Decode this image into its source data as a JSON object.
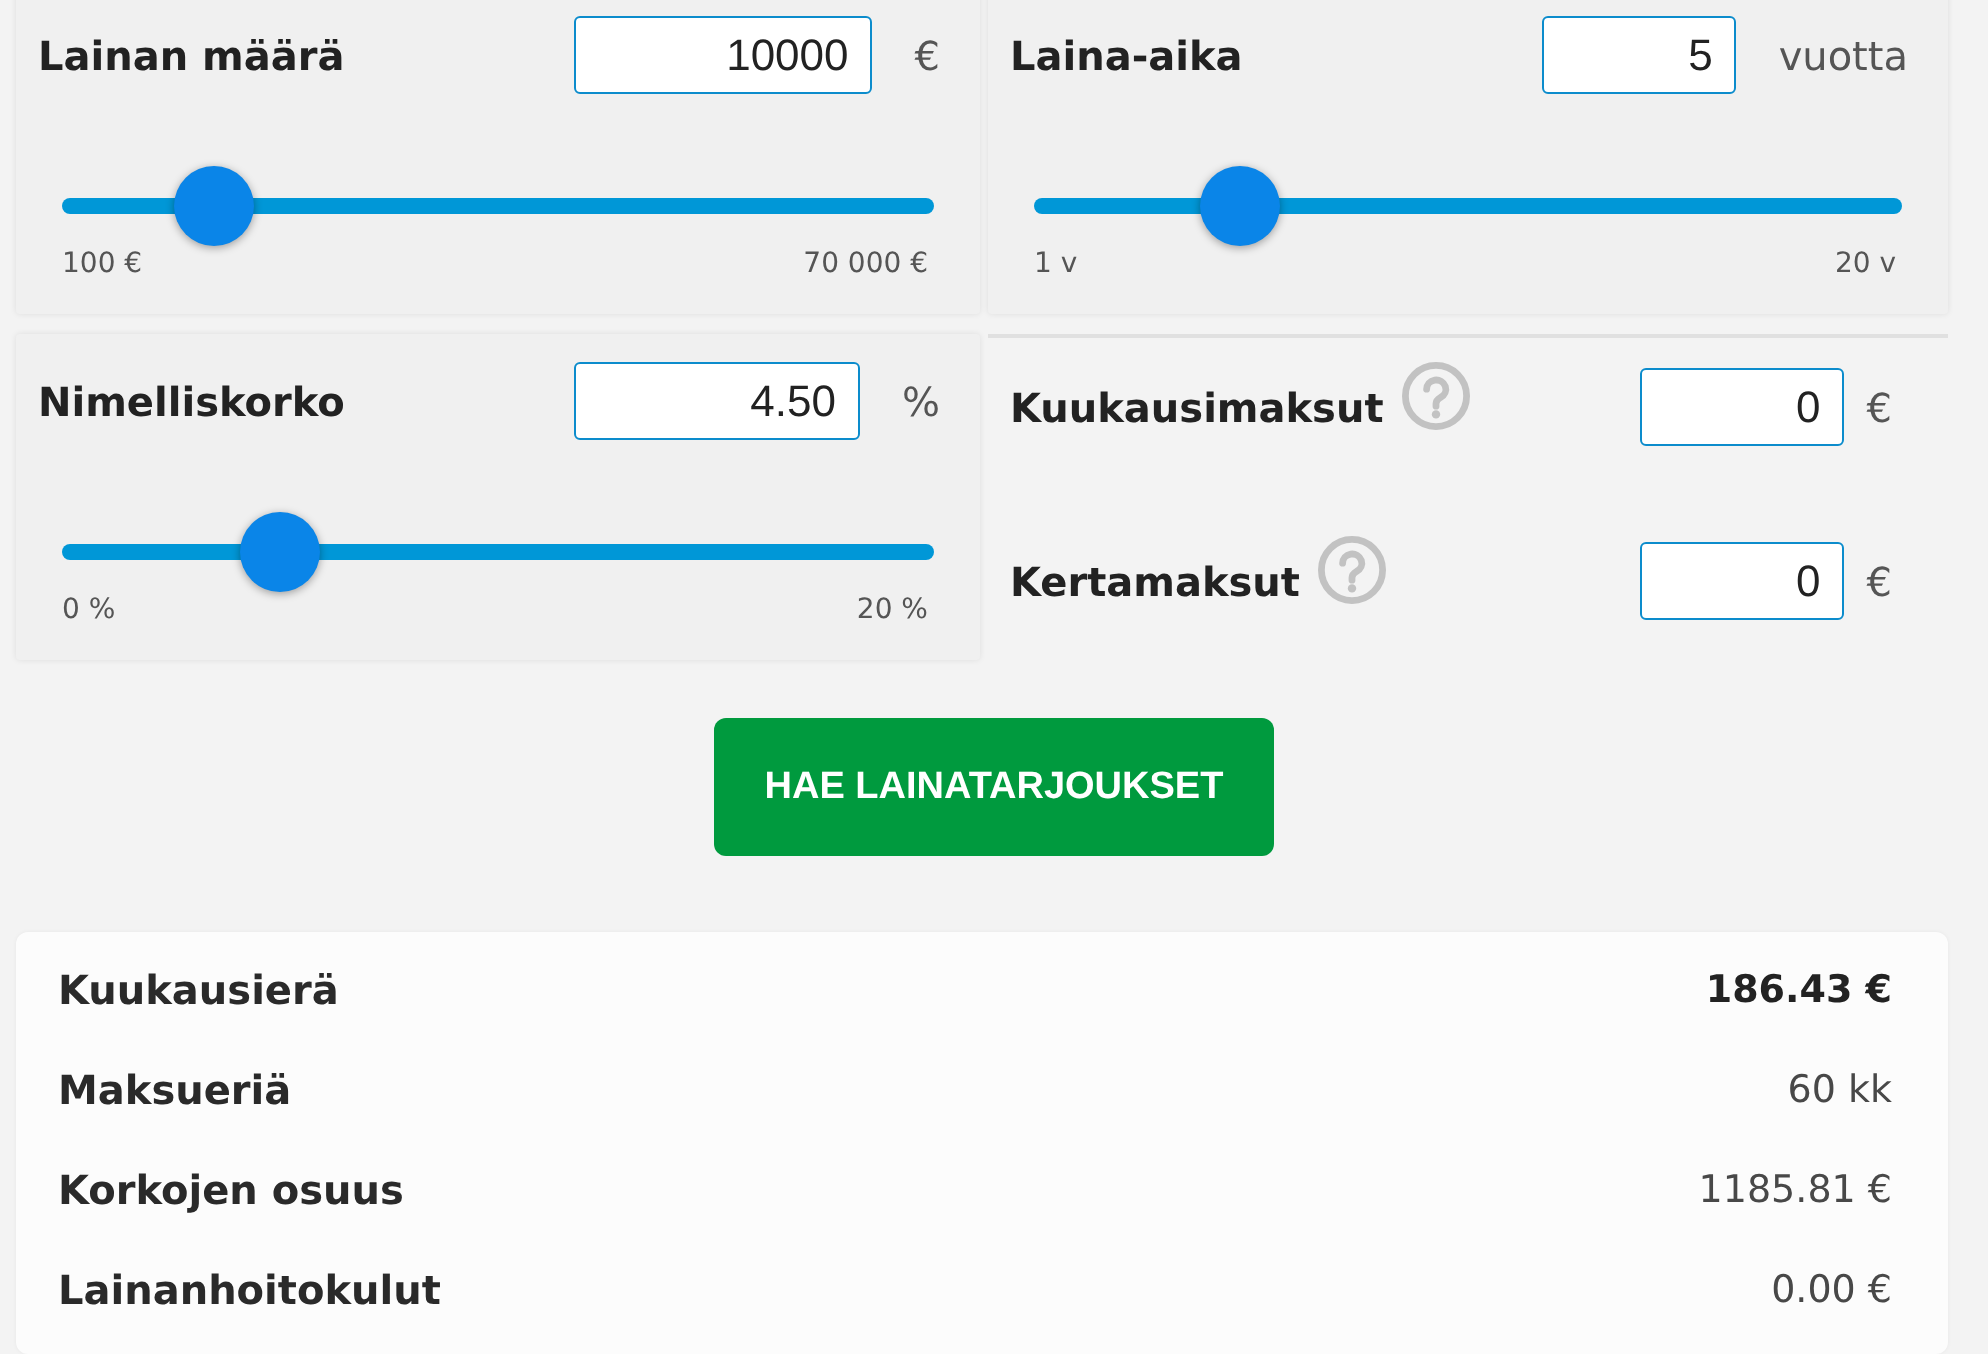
{
  "loan_sliders": [
    {
      "label": "Lainan määrä",
      "value": "10000",
      "unit": "€",
      "level": 0.1416,
      "min_label": "100 €",
      "max_label": "70 000 €"
    },
    {
      "label": "Laina-aika",
      "value": "5",
      "unit": "vuotta",
      "level": 0.2105,
      "min_label": "1 v",
      "max_label": "20 v"
    },
    {
      "label": "Nimelliskorko",
      "value": "4.50",
      "unit": "%",
      "level": 0.225,
      "min_label": "0 %",
      "max_label": "20 %"
    }
  ],
  "fees": [
    {
      "label": "Kuukausimaksut",
      "help": true,
      "value": "0",
      "unit": "€"
    },
    {
      "label": "Kertamaksut",
      "help": true,
      "value": "0",
      "unit": "€"
    }
  ],
  "submit_button": {
    "label": "HAE LAINATARJOUKSET"
  },
  "results": [
    {
      "label": "Kuukausierä",
      "value": "186.43 €",
      "emphasized": true
    },
    {
      "label": "Maksueriä",
      "value": "60 kk",
      "emphasized": false
    },
    {
      "label": "Korkojen osuus",
      "value": "1185.81 €",
      "emphasized": false
    },
    {
      "label": "Lainanhoitokulut",
      "value": "0.00 €",
      "emphasized": false
    }
  ]
}
